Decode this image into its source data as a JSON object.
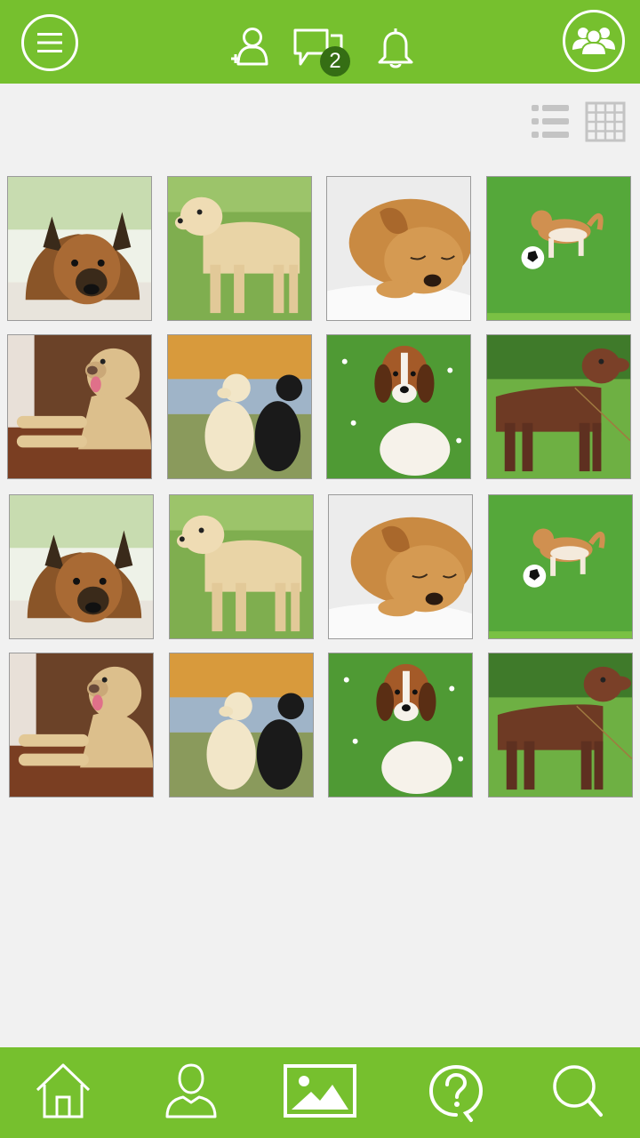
{
  "topbar": {
    "messages_badge": "2",
    "accent": "#76c02e",
    "badge_color": "#356e14"
  },
  "view_options": [
    "list-view",
    "grid-view"
  ],
  "gallery": {
    "photos": [
      "german-shepherd-lying",
      "yellow-labrador-standing",
      "golden-puppy-sleeping",
      "puppy-with-soccer-ball",
      "labrador-leaning-on-desk",
      "yellow-and-black-labradors-sitting",
      "beagle-puppy-in-grass",
      "chocolate-labrador-standing",
      "german-shepherd-lying",
      "yellow-labrador-standing",
      "golden-puppy-sleeping",
      "puppy-with-soccer-ball",
      "labrador-leaning-on-desk",
      "yellow-and-black-labradors-sitting",
      "beagle-puppy-in-grass",
      "chocolate-labrador-standing"
    ]
  },
  "bottom_nav": [
    "home-icon",
    "profile-icon",
    "gallery-icon",
    "help-icon",
    "search-icon"
  ]
}
